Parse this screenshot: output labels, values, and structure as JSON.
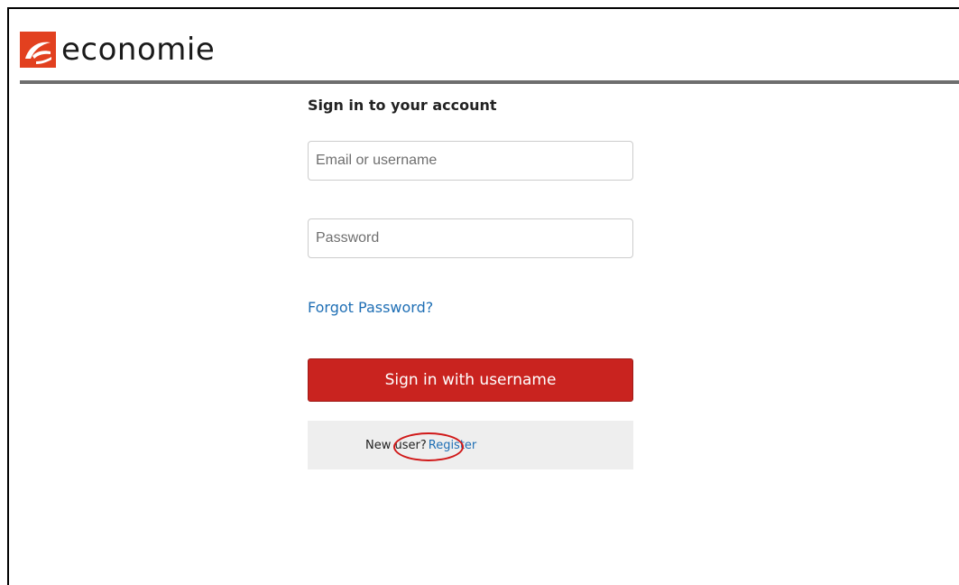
{
  "header": {
    "logo_text": "economie",
    "logo_icon": "economie-logo-icon",
    "brand_color": "#e2401f",
    "rule_color": "#6e6e6e"
  },
  "login": {
    "title": "Sign in to your account",
    "email_placeholder": "Email or username",
    "email_value": "",
    "password_placeholder": "Password",
    "password_value": "",
    "forgot_label": "Forgot Password?",
    "signin_label": "Sign in with username",
    "signin_color": "#c9231f",
    "new_user_text": "New user?",
    "register_label": "Register",
    "link_color": "#1f6fb5"
  },
  "annotation": {
    "shape": "ellipse",
    "color": "#d01818",
    "target": "register-link"
  }
}
